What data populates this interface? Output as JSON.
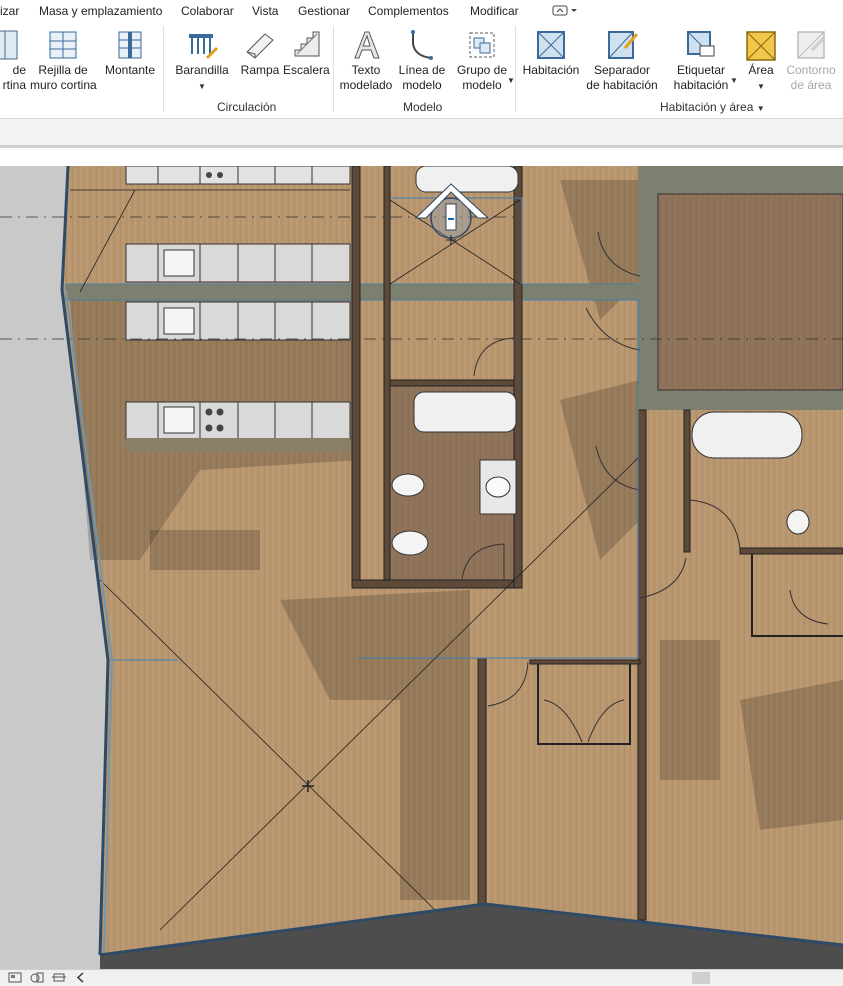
{
  "menubar": {
    "items": [
      "izar",
      "Masa y emplazamiento",
      "Colaborar",
      "Vista",
      "Gestionar",
      "Complementos",
      "Modificar"
    ]
  },
  "ribbon": {
    "buttons": {
      "muro_cortina": "de\nrtina",
      "rejilla": "Rejilla de\nmuro cortina",
      "montante": "Montante",
      "barandilla": "Barandilla",
      "rampa": "Rampa",
      "escalera": "Escalera",
      "texto_modelado": "Texto\nmodelado",
      "linea_modelo": "Línea de\nmodelo",
      "grupo_modelo": "Grupo de\nmodelo",
      "habitacion": "Habitación",
      "separador": "Separador\nde habitación",
      "etiquetar": "Etiquetar\nhabitación",
      "area": "Área",
      "contorno_area": "Contorno\nde área"
    },
    "panels": {
      "circulacion": "Circulación",
      "modelo": "Modelo",
      "habitacion_area": "Habitación y área"
    }
  },
  "colors": {
    "floor": "#b89776",
    "wall": "#5e4a3a",
    "wall_gray": "#7d806f",
    "selection": "#3c7fb1",
    "glass": "#6f97ae",
    "outside": "#c9c9c9",
    "accent_area": "#f2c64a"
  },
  "icons": [
    "expand-icon",
    "scale-icon",
    "crop-icon",
    "scroll-left-icon"
  ]
}
